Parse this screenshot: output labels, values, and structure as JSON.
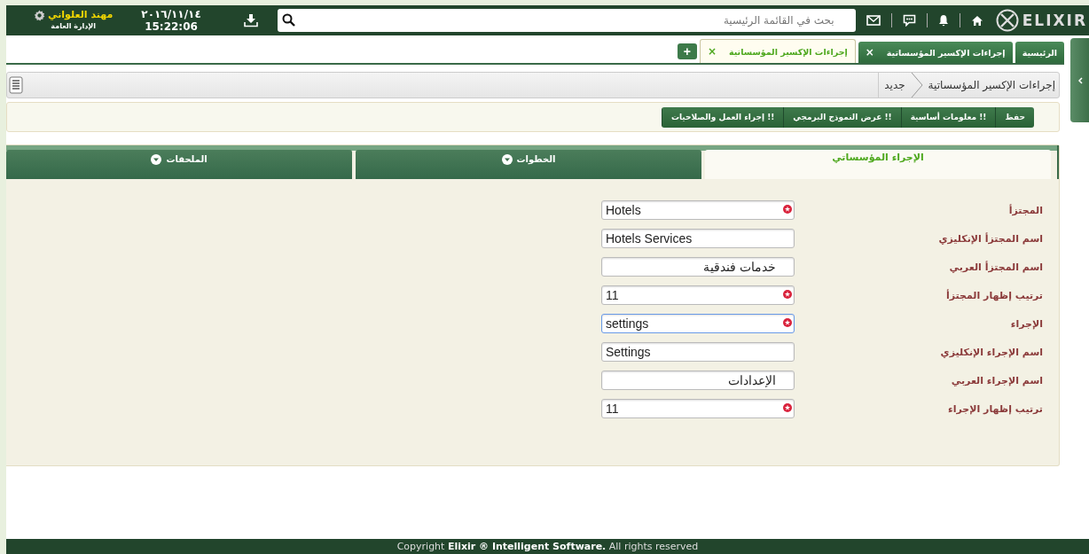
{
  "header": {
    "logo": "ELIXIR",
    "search": {
      "placeholder": "بحث في القائمة الرئيسية"
    },
    "date": "٢٠١٦/١١/١٤",
    "time": "15:22:06",
    "user": {
      "name": "مهند العلواني",
      "role": "الإدارة العامة"
    }
  },
  "tabs": [
    {
      "label": "الرئيسية",
      "selected": false
    },
    {
      "label": "إجراءات الإكسير المؤسساتية",
      "close": "×",
      "selected": false
    },
    {
      "label": "إجراءات الإكسير المؤسساتية",
      "close": "×",
      "selected": true
    }
  ],
  "add_tab": "+",
  "breadcrumb": [
    "إجراءات الإكسير المؤسساتية",
    "جديد"
  ],
  "toolbar": [
    "حفظ",
    "!! معلومات أساسية",
    "!! عرض النموذج البرمجي",
    "!! إجراء العمل والصلاحيات"
  ],
  "section_tabs": [
    {
      "label": "الإجراء المؤسساتي",
      "selected": true
    },
    {
      "label": "الخطوات",
      "selected": false
    },
    {
      "label": "الملحقات",
      "selected": false
    }
  ],
  "fields": [
    {
      "label": "المجتزأ",
      "value": "Hotels",
      "required": true,
      "focused": false
    },
    {
      "label": "اسم المجتزأ الإنكليزي",
      "value": "Hotels Services",
      "required": false,
      "focused": false
    },
    {
      "label": "اسم المجتزأ العربي",
      "value": "خدمات فندقية",
      "required": false,
      "focused": false
    },
    {
      "label": "ترتيب إظهار المجتزأ",
      "value": "11",
      "required": true,
      "focused": false
    },
    {
      "label": "الإجراء",
      "value": "settings",
      "required": true,
      "focused": true
    },
    {
      "label": "اسم الإجراء الإنكليزي",
      "value": "Settings",
      "required": false,
      "focused": false
    },
    {
      "label": "اسم الإجراء العربي",
      "value": "الإعدادات",
      "required": false,
      "focused": false
    },
    {
      "label": "ترتيب إظهار الإجراء",
      "value": "11",
      "required": true,
      "focused": false
    }
  ],
  "footer": "Copyright **Elixir ® Intelligent Software.** All rights reserved"
}
